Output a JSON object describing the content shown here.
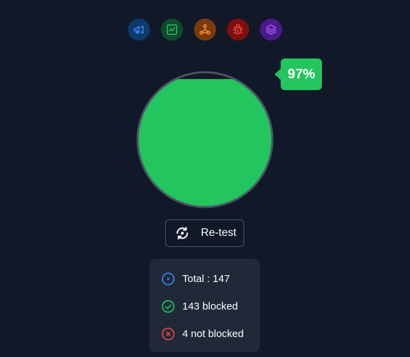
{
  "categories": [
    {
      "name": "ads",
      "icon": "megaphone-icon",
      "color": "#3b82f6"
    },
    {
      "name": "analytics",
      "icon": "chart-line-icon",
      "color": "#22c55e"
    },
    {
      "name": "network",
      "icon": "network-nodes-icon",
      "color": "#fb923c"
    },
    {
      "name": "bug",
      "icon": "bug-icon",
      "color": "#ef4444"
    },
    {
      "name": "layers",
      "icon": "layers-icon",
      "color": "#a855f7"
    }
  ],
  "gauge": {
    "percent_label": "97%",
    "blocked_fraction": 0.97,
    "fill_color": "#22c55e",
    "empty_color": "#111827",
    "ring_color": "#4b5563"
  },
  "retest": {
    "label": "Re-test"
  },
  "stats": {
    "total_label": "Total : 147",
    "blocked_label": "143 blocked",
    "not_blocked_label": "4 not blocked",
    "total_color": "#3b82f6",
    "blocked_color": "#22c55e",
    "not_blocked_color": "#ef4444"
  }
}
